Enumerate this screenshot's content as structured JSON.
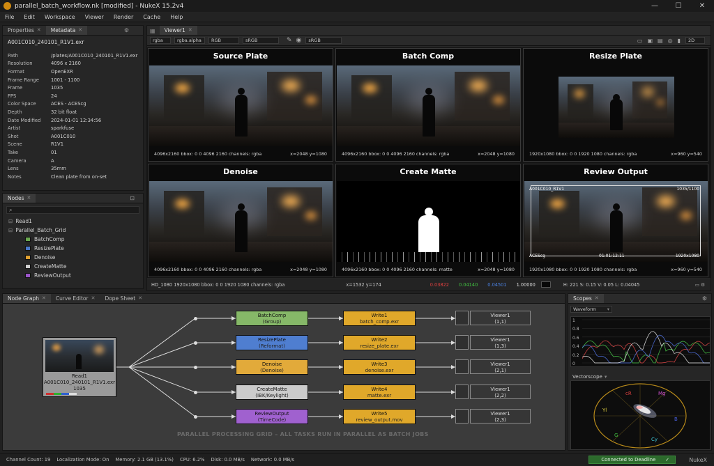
{
  "app": {
    "title": "parallel_batch_workflow.nk [modified] - NukeX 15.2v4",
    "brand": "NukeX"
  },
  "window_controls": [
    "—",
    "☐",
    "✕"
  ],
  "menu": [
    "File",
    "Edit",
    "Workspace",
    "Viewer",
    "Render",
    "Cache",
    "Help"
  ],
  "left_tabs": {
    "properties": "Properties",
    "metadata": "Metadata"
  },
  "metadata": {
    "title": "A001C010_240101_R1V1.exr",
    "rows": [
      {
        "k": "Path",
        "v": "/plates/A001C010_240101_R1V1.exr"
      },
      {
        "k": "Resolution",
        "v": "4096 x 2160"
      },
      {
        "k": "Format",
        "v": "OpenEXR"
      },
      {
        "k": "Frame Range",
        "v": "1001 - 1100"
      },
      {
        "k": "Frame",
        "v": "1035"
      },
      {
        "k": "FPS",
        "v": "24"
      },
      {
        "k": "Color Space",
        "v": "ACES - ACEScg"
      },
      {
        "k": "Depth",
        "v": "32 bit float"
      },
      {
        "k": "Date Modified",
        "v": "2024-01-01 12:34:56"
      },
      {
        "k": "Artist",
        "v": "sparkfuse"
      },
      {
        "k": "Shot",
        "v": "A001C010"
      },
      {
        "k": "Scene",
        "v": "R1V1"
      },
      {
        "k": "Take",
        "v": "01"
      },
      {
        "k": "Camera",
        "v": "A"
      },
      {
        "k": "Lens",
        "v": "35mm"
      },
      {
        "k": "Notes",
        "v": "Clean plate from on-set"
      }
    ]
  },
  "nodes_panel": {
    "tab": "Nodes",
    "read": "Read1",
    "group": "Parallel_Batch_Grid",
    "items": [
      {
        "label": "BatchComp",
        "color": "#6aa84f"
      },
      {
        "label": "ResizePlate",
        "color": "#4a78c8"
      },
      {
        "label": "Denoise",
        "color": "#e0a030"
      },
      {
        "label": "CreateMatte",
        "color": "#cfcfcf"
      },
      {
        "label": "ReviewOutput",
        "color": "#9a55c8"
      }
    ]
  },
  "viewer": {
    "tab": "Viewer1",
    "controls": {
      "layer": "rgba",
      "channel": "rgba.alpha",
      "display": "RGB",
      "input_cs": "sRGB",
      "output_cs": "sRGB",
      "mode": "2D"
    },
    "cells": [
      {
        "title": "Source Plate",
        "info": "4096x2160   bbox: 0 0 4096 2160   channels: rgba",
        "coords": "x=2048 y=1080"
      },
      {
        "title": "Batch Comp",
        "info": "4096x2160   bbox: 0 0 4096 2160   channels: rgba",
        "coords": "x=2048 y=1080"
      },
      {
        "title": "Resize Plate",
        "info": "1920x1080   bbox: 0 0 1920 1080   channels: rgba",
        "coords": "x=960 y=540"
      },
      {
        "title": "Denoise",
        "info": "4096x2160   bbox: 0 0 4096 2160   channels: rgba",
        "coords": "x=2048 y=1080"
      },
      {
        "title": "Create Matte",
        "info": "4096x2160   bbox: 0 0 4096 2160   channels: matte",
        "coords": "x=2048 y=1080"
      },
      {
        "title": "Review Output",
        "info": "1920x1080   bbox: 0 0 1920 1080   channels: rgba",
        "coords": "x=960 y=540"
      }
    ],
    "review_overlay": {
      "name": "A001C010_R1V1",
      "frame": "1035/1100",
      "cs": "ACEScg",
      "tc": "01:01:12:11",
      "res": "1920x1080"
    },
    "status": {
      "format": "HD_1080 1920x1080   bbox: 0 0 1920 1080   channels: rgba",
      "pos": "x=1532 y=174",
      "r": "0.03822",
      "g": "0.04140",
      "b": "0.04501",
      "a": "1.00000",
      "hsvl": "H: 221   S: 0.15   V: 0.05   L: 0.04045"
    }
  },
  "bottom_tabs": [
    "Node Graph",
    "Curve Editor",
    "Dope Sheet"
  ],
  "graph": {
    "read": {
      "name": "Read1",
      "file": "A001C010_240101_R1V1.exr",
      "frame": "1035"
    },
    "rows": [
      {
        "proc": "BatchComp",
        "proc_sub": "(Group)",
        "pcolor": "#86b868",
        "write": "Write1",
        "wfile": "batch_comp.exr",
        "viewer": "Viewer1",
        "vslot": "(1,1)"
      },
      {
        "proc": "ResizePlate",
        "proc_sub": "(Reformat)",
        "pcolor": "#4f7ed0",
        "write": "Write2",
        "wfile": "resize_plate.exr",
        "viewer": "Viewer1",
        "vslot": "(1,3)"
      },
      {
        "proc": "Denoise",
        "proc_sub": "(Denoise)",
        "pcolor": "#e2aa3a",
        "write": "Write3",
        "wfile": "denoise.exr",
        "viewer": "Viewer1",
        "vslot": "(2,1)"
      },
      {
        "proc": "CreateMatte",
        "proc_sub": "(IBK/Keylight)",
        "pcolor": "#cbcbcb",
        "write": "Write4",
        "wfile": "matte.exr",
        "viewer": "Viewer1",
        "vslot": "(2,2)"
      },
      {
        "proc": "ReviewOutput",
        "proc_sub": "(TimeCode)",
        "pcolor": "#a061cf",
        "write": "Write5",
        "wfile": "review_output.mov",
        "viewer": "Viewer1",
        "vslot": "(2,3)"
      }
    ],
    "write_color": "#e0a82a",
    "caption": "PARALLEL PROCESSING GRID – ALL TASKS RUN IN PARALLEL AS BATCH JOBS"
  },
  "scopes": {
    "tab": "Scopes",
    "waveform_label": "Waveform",
    "wf_ticks": [
      "1",
      "0.8",
      "0.6",
      "0.4",
      "0.2",
      "0"
    ],
    "vectorscope_label": "Vectorscope",
    "vs_labels": {
      "r": "cR",
      "mg": "Mg",
      "yl": "Yl",
      "b": "B",
      "g": "G",
      "cy": "Cy"
    }
  },
  "footer": {
    "channel_count": "Channel Count: 19",
    "localization": "Localization Mode: On",
    "memory": "Memory: 2.1 GB (13.1%)",
    "cpu": "CPU: 6.2%",
    "disk": "Disk:  0.0 MB/s",
    "network": "Network:  0.0 MB/s",
    "deadline": "Connected to Deadline",
    "brand": "NukeX"
  }
}
